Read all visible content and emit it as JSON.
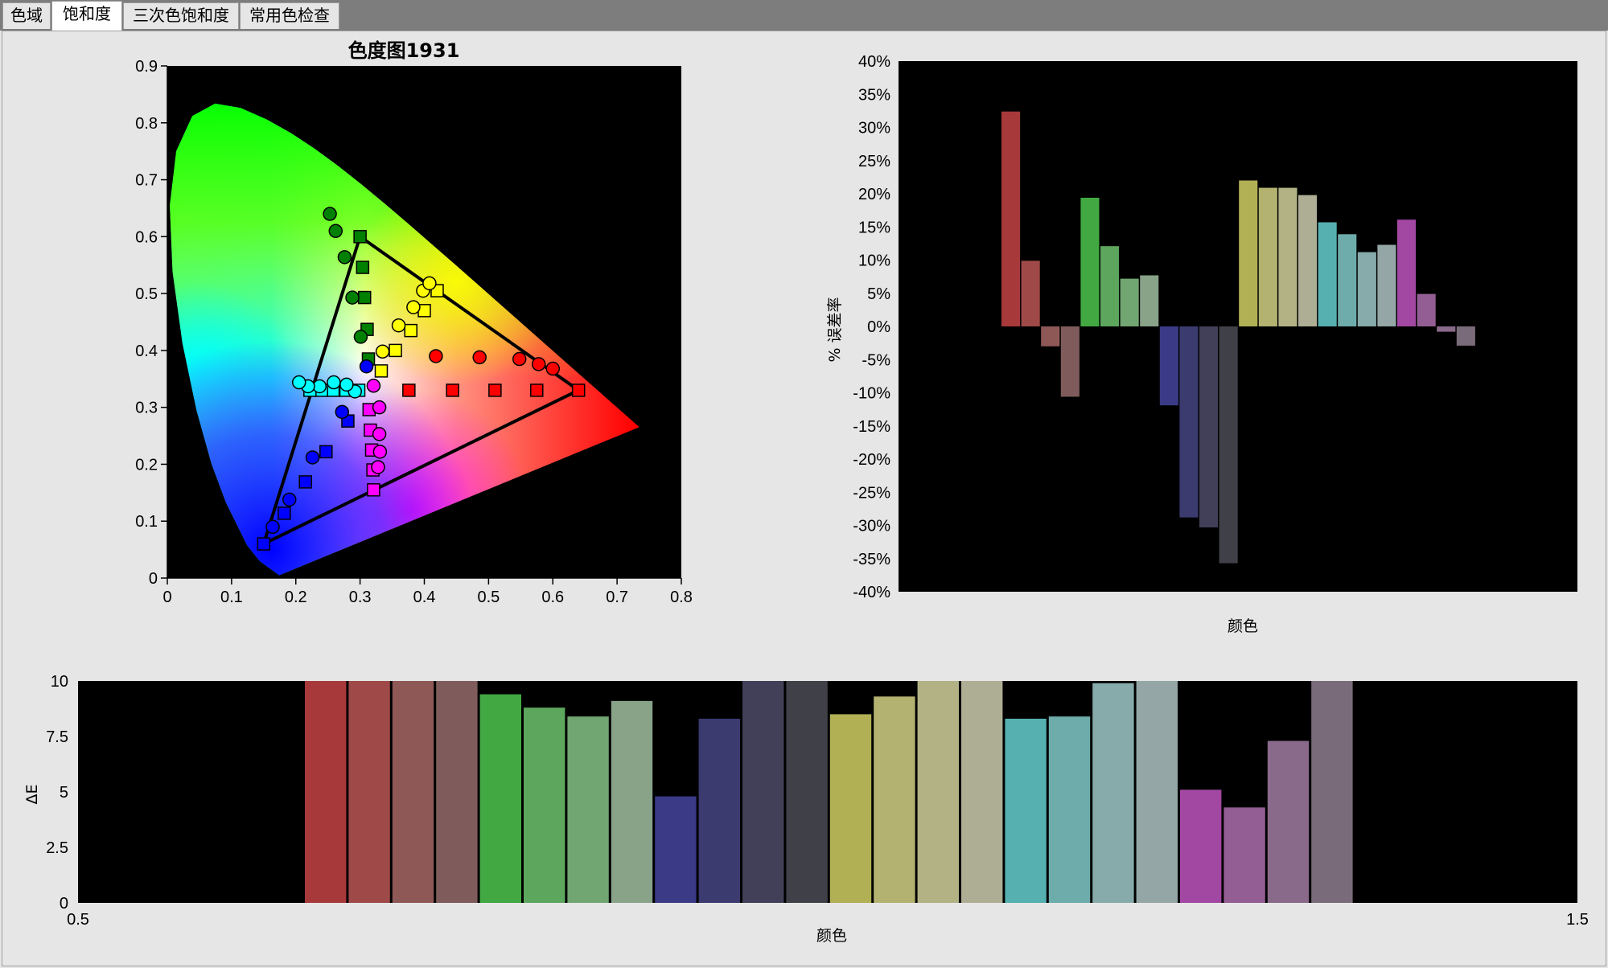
{
  "tabs": [
    {
      "label": "色域",
      "active": false
    },
    {
      "label": "饱和度",
      "active": true
    },
    {
      "label": "三次色饱和度",
      "active": false
    },
    {
      "label": "常用色检查",
      "active": false
    }
  ],
  "chart_data": [
    {
      "type": "scatter",
      "title": "色度图1931",
      "xlabel": "",
      "ylabel": "",
      "xlim": [
        0,
        0.8
      ],
      "ylim": [
        0,
        0.9
      ],
      "xticks": [
        "0",
        "0.1",
        "0.2",
        "0.3",
        "0.4",
        "0.5",
        "0.6",
        "0.7",
        "0.8"
      ],
      "yticks": [
        "0",
        "0.1",
        "0.2",
        "0.3",
        "0.4",
        "0.5",
        "0.6",
        "0.7",
        "0.8",
        "0.9"
      ],
      "gamut_triangle": [
        [
          0.64,
          0.33
        ],
        [
          0.3,
          0.6
        ],
        [
          0.15,
          0.06
        ]
      ],
      "series": [
        {
          "marker": "square",
          "color": "#ff0000",
          "points": [
            [
              0.376,
              0.33
            ],
            [
              0.444,
              0.33
            ],
            [
              0.51,
              0.33
            ],
            [
              0.575,
              0.33
            ],
            [
              0.64,
              0.33
            ]
          ]
        },
        {
          "marker": "circle",
          "color": "#ff0000",
          "points": [
            [
              0.418,
              0.39
            ],
            [
              0.486,
              0.388
            ],
            [
              0.548,
              0.385
            ],
            [
              0.578,
              0.376
            ],
            [
              0.6,
              0.368
            ]
          ]
        },
        {
          "marker": "square",
          "color": "#008000",
          "points": [
            [
              0.313,
              0.385
            ],
            [
              0.311,
              0.437
            ],
            [
              0.307,
              0.493
            ],
            [
              0.304,
              0.546
            ],
            [
              0.3,
              0.6
            ]
          ]
        },
        {
          "marker": "circle",
          "color": "#008000",
          "points": [
            [
              0.301,
              0.424
            ],
            [
              0.288,
              0.493
            ],
            [
              0.276,
              0.564
            ],
            [
              0.262,
              0.61
            ],
            [
              0.253,
              0.64
            ]
          ]
        },
        {
          "marker": "square",
          "color": "#0000ff",
          "points": [
            [
              0.281,
              0.276
            ],
            [
              0.247,
              0.222
            ],
            [
              0.215,
              0.169
            ],
            [
              0.182,
              0.114
            ],
            [
              0.15,
              0.06
            ]
          ]
        },
        {
          "marker": "circle",
          "color": "#0000ff",
          "points": [
            [
              0.31,
              0.372
            ],
            [
              0.272,
              0.292
            ],
            [
              0.226,
              0.212
            ],
            [
              0.19,
              0.138
            ],
            [
              0.164,
              0.09
            ]
          ]
        },
        {
          "marker": "square",
          "color": "#00ffff",
          "points": [
            [
              0.298,
              0.33
            ],
            [
              0.278,
              0.33
            ],
            [
              0.258,
              0.33
            ],
            [
              0.24,
              0.33
            ],
            [
              0.222,
              0.33
            ]
          ]
        },
        {
          "marker": "circle",
          "color": "#00ffff",
          "points": [
            [
              0.292,
              0.328
            ],
            [
              0.279,
              0.34
            ],
            [
              0.259,
              0.344
            ],
            [
              0.237,
              0.337
            ],
            [
              0.219,
              0.337
            ],
            [
              0.205,
              0.344
            ]
          ]
        },
        {
          "marker": "square",
          "color": "#ff00ff",
          "points": [
            [
              0.314,
              0.296
            ],
            [
              0.316,
              0.26
            ],
            [
              0.318,
              0.225
            ],
            [
              0.32,
              0.19
            ],
            [
              0.321,
              0.155
            ]
          ]
        },
        {
          "marker": "circle",
          "color": "#ff00ff",
          "points": [
            [
              0.321,
              0.338
            ],
            [
              0.33,
              0.3
            ],
            [
              0.33,
              0.253
            ],
            [
              0.331,
              0.222
            ],
            [
              0.328,
              0.195
            ]
          ]
        },
        {
          "marker": "square",
          "color": "#ffff00",
          "points": [
            [
              0.333,
              0.364
            ],
            [
              0.355,
              0.4
            ],
            [
              0.379,
              0.435
            ],
            [
              0.4,
              0.47
            ],
            [
              0.42,
              0.505
            ]
          ]
        },
        {
          "marker": "circle",
          "color": "#ffff00",
          "points": [
            [
              0.335,
              0.398
            ],
            [
              0.36,
              0.444
            ],
            [
              0.383,
              0.476
            ],
            [
              0.398,
              0.505
            ],
            [
              0.408,
              0.518
            ]
          ]
        }
      ]
    },
    {
      "type": "bar",
      "title": "",
      "xlabel": "颜色",
      "ylabel": "% 误差率",
      "ylim": [
        -40,
        40
      ],
      "yticks": [
        "40%",
        "35%",
        "30%",
        "25%",
        "20%",
        "15%",
        "10%",
        "5%",
        "0%",
        "-5%",
        "-10%",
        "-15%",
        "-20%",
        "-25%",
        "-30%",
        "-35%",
        "-40%"
      ],
      "values": [
        32.4,
        9.9,
        -3.0,
        -10.6,
        19.4,
        12.1,
        7.2,
        7.7,
        -11.9,
        -28.8,
        -30.3,
        -35.7,
        22.0,
        20.9,
        20.9,
        19.8,
        15.7,
        13.9,
        11.2,
        12.3,
        16.1,
        4.9,
        -0.8,
        -2.9
      ],
      "colors": [
        "#a8393b",
        "#9f4a48",
        "#8e5857",
        "#7f5c5b",
        "#42a842",
        "#5da65d",
        "#71a571",
        "#88a388",
        "#3a3a86",
        "#3c3b70",
        "#414058",
        "#404048",
        "#b2b055",
        "#b3b270",
        "#b2b285",
        "#aeae95",
        "#56b0b0",
        "#6eacac",
        "#87aaaa",
        "#94a6a6",
        "#a247a2",
        "#935e93",
        "#8a6a8a",
        "#7a6b7a"
      ]
    },
    {
      "type": "bar",
      "title": "",
      "xlabel": "颜色",
      "ylabel": "ΔE",
      "xlim": [
        0.5,
        1.5
      ],
      "ylim": [
        0,
        10
      ],
      "xticks": [
        "0.5",
        "1.5"
      ],
      "yticks": [
        "0",
        "2.5",
        "5",
        "7.5",
        "10"
      ],
      "values": [
        10,
        10,
        10,
        10,
        9.4,
        8.8,
        8.4,
        9.1,
        4.8,
        8.3,
        10,
        10,
        8.5,
        9.3,
        10,
        10,
        8.3,
        8.4,
        9.9,
        10,
        5.1,
        4.3,
        7.3,
        10
      ],
      "colors": [
        "#a8393b",
        "#9f4a48",
        "#8e5857",
        "#7f5c5b",
        "#42a842",
        "#5da65d",
        "#71a571",
        "#88a388",
        "#3a3a86",
        "#3c3b70",
        "#414058",
        "#404048",
        "#b2b055",
        "#b3b270",
        "#b2b285",
        "#aeae95",
        "#56b0b0",
        "#6eacac",
        "#87aaaa",
        "#94a6a6",
        "#a247a2",
        "#935e93",
        "#8a6a8a",
        "#7a6b7a"
      ]
    }
  ]
}
